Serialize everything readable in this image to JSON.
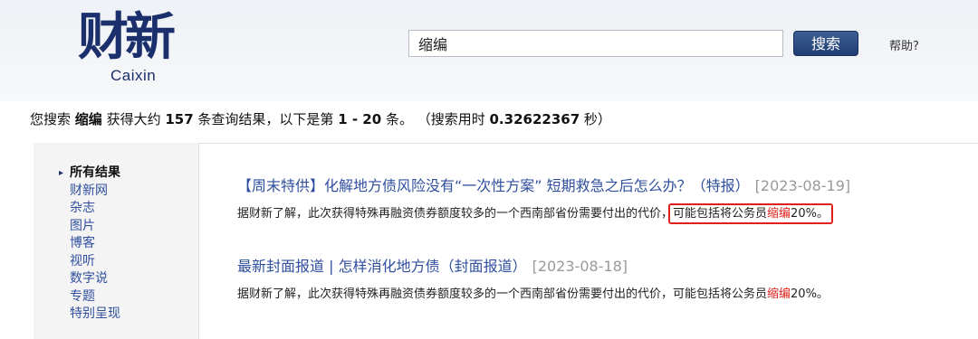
{
  "header": {
    "logo_cn": "财新",
    "logo_en": "Caixin",
    "search_value": "缩编",
    "search_button": "搜索",
    "help_link": "帮助?"
  },
  "summary": {
    "prefix": "您搜索 ",
    "keyword": "缩编",
    "mid1": " 获得大约 ",
    "count": "157",
    "mid2": " 条查询结果，以下是第 ",
    "range": "1 - 20",
    "mid3": " 条。 （搜索用时 ",
    "time": "0.32622367",
    "suffix": " 秒）"
  },
  "sidebar": {
    "items": [
      {
        "label": "所有结果"
      },
      {
        "label": "财新网"
      },
      {
        "label": "杂志"
      },
      {
        "label": "图片"
      },
      {
        "label": "博客"
      },
      {
        "label": "视听"
      },
      {
        "label": "数字说"
      },
      {
        "label": "专题"
      },
      {
        "label": "特别呈现"
      }
    ]
  },
  "results": [
    {
      "title": "【周末特供】化解地方债风险没有“一次性方案” 短期救急之后怎么办？（特报）",
      "date": "[2023-08-19]",
      "snippet_pre": "据财新了解，此次获得特殊再融资债券额度较多的一个西南部省份需要付出的代价，",
      "snippet_box_pre": "可能包括将公务员",
      "keyword": "缩编",
      "snippet_post": "20%。"
    },
    {
      "title": "最新封面报道 | 怎样消化地方债（封面报道）",
      "date": "[2023-08-18]",
      "snippet_pre": "据财新了解，此次获得特殊再融资债券额度较多的一个西南部省份需要付出的代价，可能包括将公务员",
      "keyword": "缩编",
      "snippet_post": "20%。"
    }
  ],
  "colors": {
    "brand": "#1a2f6b",
    "link": "#2f4f9e",
    "highlight": "#e0201b"
  }
}
